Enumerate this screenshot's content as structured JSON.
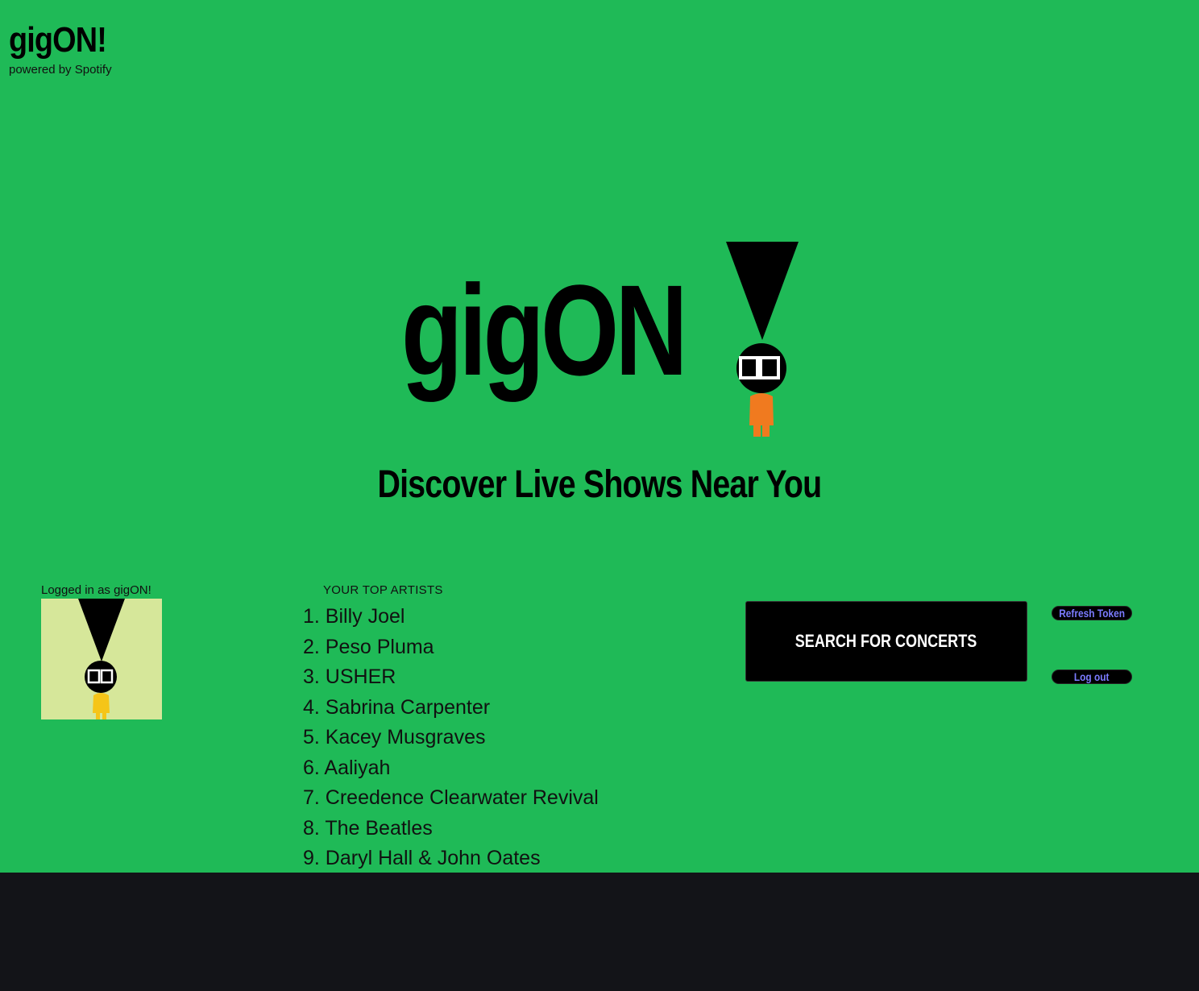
{
  "header": {
    "title": "gigON!",
    "subtitle": "powered by Spotify"
  },
  "hero": {
    "logo_text": "gigON",
    "tagline": "Discover Live Shows Near You"
  },
  "profile": {
    "label": "Logged in as gigON!"
  },
  "top_artists": {
    "heading": "YOUR TOP ARTISTS",
    "items": [
      "1. Billy Joel",
      "2. Peso Pluma",
      "3. USHER",
      "4. Sabrina Carpenter",
      "5. Kacey Musgraves",
      "6. Aaliyah",
      "7. Creedence Clearwater Revival",
      "8. The Beatles",
      "9. Daryl Hall & John Oates"
    ]
  },
  "actions": {
    "search_label": "SEARCH FOR CONCERTS",
    "refresh_label": "Refresh Token",
    "logout_label": "Log out"
  },
  "colors": {
    "background_green": "#1fba57",
    "footer_dark": "#131418",
    "mascot_orange": "#f07a1f",
    "mascot_yellow": "#f5c518",
    "avatar_bg": "#d6e79a",
    "link_blue": "#7b7bff"
  }
}
